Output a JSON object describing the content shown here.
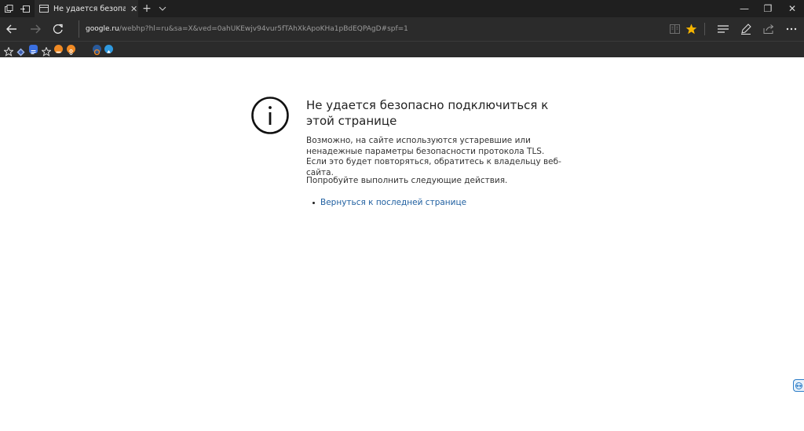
{
  "tab": {
    "title": "Не удается безопасно п",
    "close_icon": "close-icon"
  },
  "titlebar": {
    "new_tab_label": "+",
    "tab_list_label": "⌄"
  },
  "window": {
    "minimize": "—",
    "restore": "❐",
    "close": "✕"
  },
  "address": {
    "host": "google.ru",
    "rest": "/webhp?hl=ru&sa=X&ved=0ahUKEwjv94vur5fTAhXkApoKHa1pBdEQPAgD#spf=1"
  },
  "favorites": {
    "icons": [
      "star-icon",
      "diamond-icon",
      "document-icon",
      "star-outline-icon",
      "orange-circle-icon",
      "orange-circle-icon",
      "dots-icon",
      "circle-icon",
      "blue-circle-icon"
    ],
    "colors": {
      "blue_doc": "#3a6fe0",
      "orange": "#f08a24",
      "blue": "#2f9ae0"
    }
  },
  "error": {
    "title": "Не удается безопасно подключиться к этой странице",
    "description": "Возможно, на сайте используются устаревшие или ненадежные параметры безопасности протокола TLS. Если это будет повторяться, обратитесь к владельцу веб-сайта.",
    "try_text": "Попробуйте выполнить следующие действия.",
    "link_text": "Вернуться к последней странице"
  },
  "colors": {
    "chrome_dark": "#2b2b2b",
    "titlebar": "#1f1f1f",
    "accent_star": "#f5b400",
    "link": "#1f5fa0"
  }
}
